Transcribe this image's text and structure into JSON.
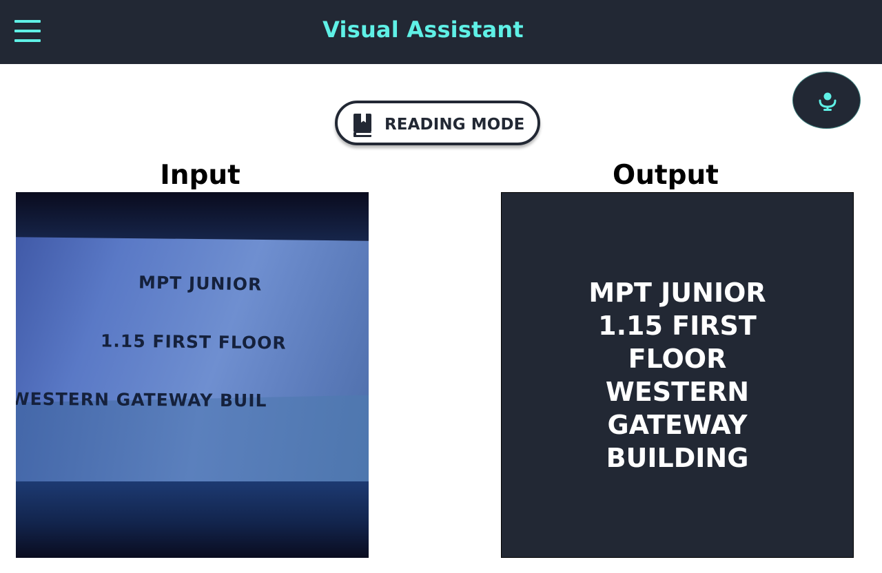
{
  "header": {
    "title": "Visual Assistant",
    "menu_icon": "hamburger-icon"
  },
  "mic_button": {
    "icon": "microphone-icon"
  },
  "mode_button": {
    "icon": "book-icon",
    "label": "READING MODE"
  },
  "input_panel": {
    "title": "Input",
    "photo_text": [
      "MPT JUNIOR",
      "1.15 FIRST FLOOR",
      "WESTERN GATEWAY BUIL"
    ]
  },
  "output_panel": {
    "title": "Output",
    "text": "MPT JUNIOR 1.15 FIRST FLOOR WESTERN GATEWAY BUILDING"
  },
  "colors": {
    "header_bg": "#222834",
    "accent": "#5ff0e6",
    "output_bg": "#222834",
    "output_text": "#ffffff"
  }
}
